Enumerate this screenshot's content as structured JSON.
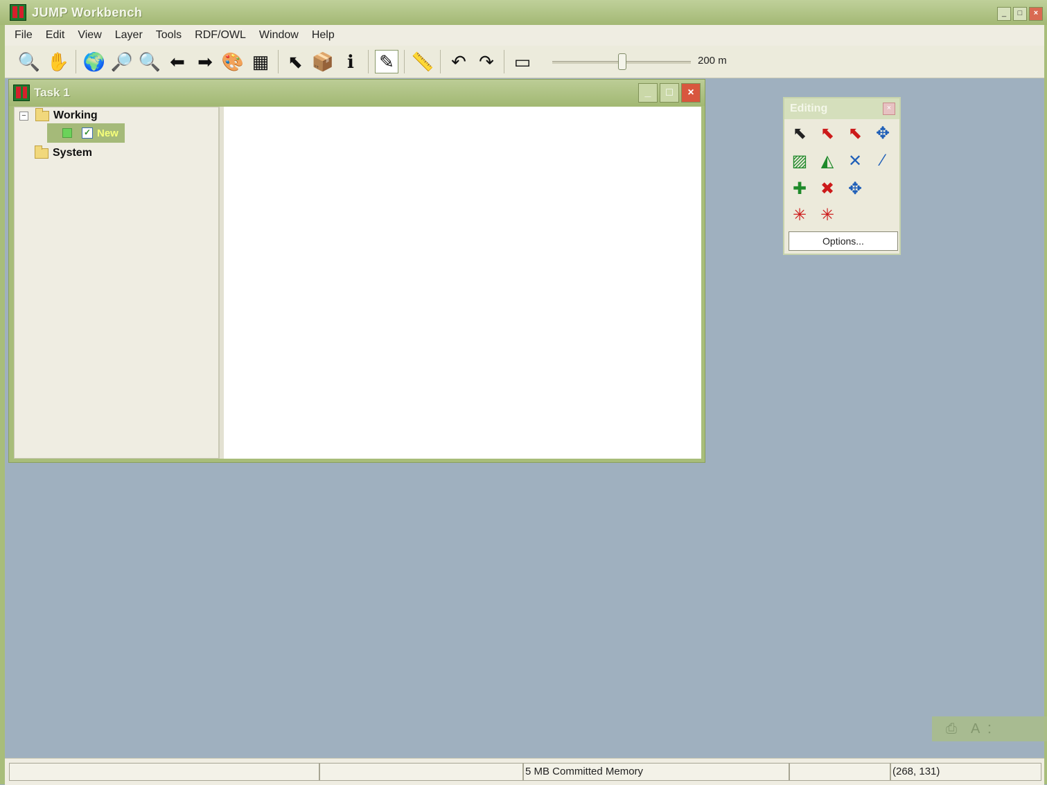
{
  "app": {
    "title": "JUMP Workbench"
  },
  "menu": [
    "File",
    "Edit",
    "View",
    "Layer",
    "Tools",
    "RDF/OWL",
    "Window",
    "Help"
  ],
  "toolbar": {
    "buttons": [
      {
        "name": "zoom-tool",
        "glyph": "🔍",
        "pressed": true
      },
      {
        "name": "pan-tool",
        "glyph": "✋",
        "pressed": false
      },
      {
        "name": "zoom-full-extent",
        "glyph": "🌍",
        "pressed": false
      },
      {
        "name": "zoom-to-selected",
        "glyph": "🔎",
        "pressed": false
      },
      {
        "name": "zoom-fence",
        "glyph": "🔍",
        "pressed": false
      },
      {
        "name": "zoom-previous",
        "glyph": "⬅",
        "pressed": false
      },
      {
        "name": "zoom-next",
        "glyph": "➡",
        "pressed": false
      },
      {
        "name": "change-styles",
        "glyph": "🎨",
        "pressed": false
      },
      {
        "name": "attribute-table",
        "glyph": "▦",
        "pressed": false
      },
      {
        "name": "select-features",
        "glyph": "⬉",
        "pressed": false
      },
      {
        "name": "select-box",
        "glyph": "📦",
        "pressed": false
      },
      {
        "name": "feature-info",
        "glyph": "ℹ",
        "pressed": false
      },
      {
        "name": "editing-toolbox",
        "glyph": "✎",
        "pressed": true
      },
      {
        "name": "measure",
        "glyph": "📏",
        "pressed": false
      },
      {
        "name": "undo",
        "glyph": "↶",
        "pressed": false
      },
      {
        "name": "redo",
        "glyph": "↷",
        "pressed": false
      },
      {
        "name": "fence",
        "glyph": "▭",
        "pressed": false
      }
    ],
    "zoom_label": "200 m"
  },
  "task": {
    "title": "Task 1",
    "tree": {
      "working": "Working",
      "layer_new": "New",
      "system": "System"
    }
  },
  "editing": {
    "title": "Editing",
    "tools": [
      {
        "name": "select-feature",
        "glyph": "⬉",
        "color": "#222222"
      },
      {
        "name": "select-part",
        "glyph": "⬉",
        "color": "#cc1a1a"
      },
      {
        "name": "select-linestring",
        "glyph": "⬉",
        "color": "#cc1a1a"
      },
      {
        "name": "move-selected",
        "glyph": "✥",
        "color": "#1f5fb8"
      },
      {
        "name": "draw-rectangle",
        "glyph": "▨",
        "color": "#1f8a2a"
      },
      {
        "name": "draw-polygon",
        "glyph": "◭",
        "color": "#1f8a2a"
      },
      {
        "name": "draw-linestring",
        "glyph": "✕",
        "color": "#1f5fb8"
      },
      {
        "name": "draw-point",
        "glyph": "⁄",
        "color": "#1f5fb8"
      },
      {
        "name": "insert-vertex",
        "glyph": "✚",
        "color": "#1f8a2a"
      },
      {
        "name": "delete-vertex",
        "glyph": "✖",
        "color": "#cc1a1a"
      },
      {
        "name": "move-vertex",
        "glyph": "✥",
        "color": "#1f5fb8"
      },
      {
        "name": "snap-vertex",
        "glyph": "✳",
        "color": "#cc1a1a"
      },
      {
        "name": "snap-vertices",
        "glyph": "✳",
        "color": "#cc1a1a"
      }
    ],
    "options_label": "Options..."
  },
  "statusbar": {
    "cell1": "",
    "cell2": "",
    "memory": "5 MB Committed Memory",
    "cell4": "",
    "coords": "(268, 131)"
  },
  "colors": {
    "desktop": "#9fb0bf",
    "title_green": "#a8bd7a",
    "selection": "#a5ba79"
  }
}
